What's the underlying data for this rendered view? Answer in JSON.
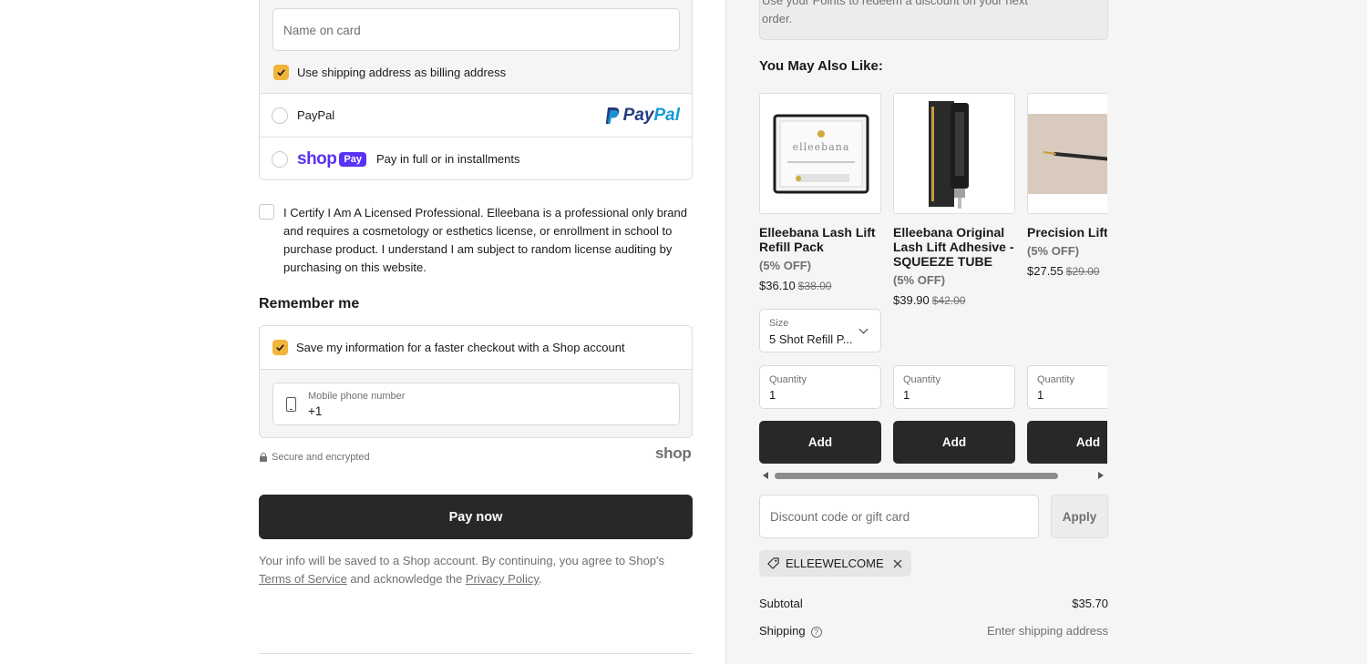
{
  "payment": {
    "name_on_card_placeholder": "Name on card",
    "billing_same_label": "Use shipping address as billing address",
    "paypal_label": "PayPal",
    "paypal_logo": {
      "part1": "Pay",
      "part2": "Pal"
    },
    "shoppay_logo": {
      "shop": "shop",
      "pay": "Pay"
    },
    "shoppay_label": "Pay in full or in installments"
  },
  "certify_text": "I Certify I Am A Licensed Professional. Elleebana is a professional only brand and requires a cosmetology or esthetics license, or enrollment in school to purchase product. I understand I am subject to random license auditing by purchasing on this website.",
  "remember": {
    "title": "Remember me",
    "save_label": "Save my information for a faster checkout with a Shop account",
    "phone_label": "Mobile phone number",
    "phone_value": "+1"
  },
  "secure_text": "Secure and encrypted",
  "shop_mark": "shop",
  "pay_now_label": "Pay now",
  "legal": {
    "text1": "Your info will be saved to a Shop account. By continuing, you agree to Shop's",
    "terms_link": "Terms of Service",
    "text2": " and acknowledge the ",
    "privacy_link": "Privacy Policy",
    "text3": "."
  },
  "points_text": "Use your Points to redeem a discount on your next order.",
  "ymal": {
    "title": "You May Also Like:",
    "products": [
      {
        "title": "Elleebana Lash Lift Refill Pack",
        "discount": "(5% OFF)",
        "price": "$36.10",
        "compare_price": "$38.00",
        "size_label": "Size",
        "size_value": "5 Shot Refill P...",
        "qty_label": "Quantity",
        "qty_value": "1",
        "add_label": "Add"
      },
      {
        "title": "Elleebana Original Lash Lift Adhesive - SQUEEZE TUBE",
        "discount": "(5% OFF)",
        "price": "$39.90",
        "compare_price": "$42.00",
        "qty_label": "Quantity",
        "qty_value": "1",
        "add_label": "Add"
      },
      {
        "title": "Precision Lifter",
        "discount": "(5% OFF)",
        "price": "$27.55",
        "compare_price": "$29.00",
        "qty_label": "Quantity",
        "qty_value": "1",
        "add_label": "Add"
      }
    ]
  },
  "discount": {
    "placeholder": "Discount code or gift card",
    "apply_label": "Apply",
    "applied_code": "ELLEEWELCOME"
  },
  "summary": {
    "subtotal_label": "Subtotal",
    "subtotal_value": "$35.70",
    "shipping_label": "Shipping",
    "shipping_value": "Enter shipping address"
  },
  "colors": {
    "checkbox_accent": "#f1b53a",
    "button_dark": "#282828",
    "shop_purple": "#5a31f4",
    "paypal_dark": "#253b80",
    "paypal_light": "#179bd7"
  },
  "product_logo_text": "elleebana"
}
